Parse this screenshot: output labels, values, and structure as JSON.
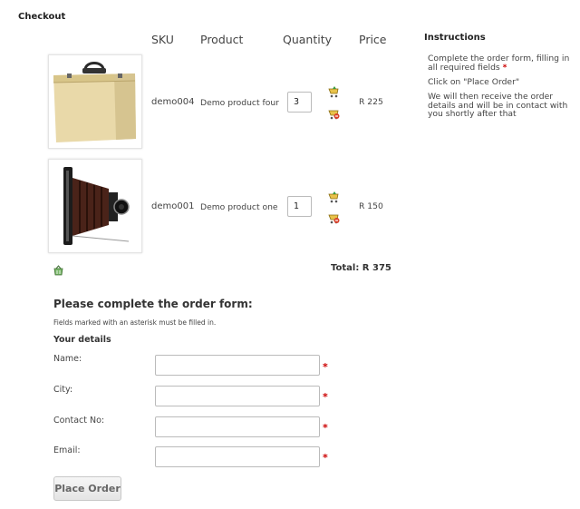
{
  "page": {
    "heading": "Checkout"
  },
  "table": {
    "headers": {
      "sku": "SKU",
      "product": "Product",
      "quantity": "Quantity",
      "price": "Price"
    },
    "rows": [
      {
        "sku": "demo004",
        "product": "Demo product four",
        "quantity": "3",
        "price": "R 225",
        "image": "wooden-case"
      },
      {
        "sku": "demo001",
        "product": "Demo product one",
        "quantity": "1",
        "price": "R 150",
        "image": "vintage-folding-camera"
      }
    ],
    "row_icons": [
      "update-cart-icon",
      "remove-item-icon"
    ],
    "clear_icon": "empty-cart-icon",
    "total": "Total: R 375"
  },
  "instructions": {
    "title": "Instructions",
    "step1": "Complete the order form, filling in all required fields",
    "step1_marker": "*",
    "step2": "Click on \"Place Order\"",
    "step3": "We will then receive the order details and will be in contact with you shortly after that"
  },
  "form": {
    "title": "Please complete the order form:",
    "note": "Fields marked with an asterisk must be filled in.",
    "section": "Your details",
    "required_marker": "*",
    "fields": [
      {
        "label": "Name:",
        "value": ""
      },
      {
        "label": "City:",
        "value": ""
      },
      {
        "label": "Contact No:",
        "value": ""
      },
      {
        "label": "Email:",
        "value": ""
      }
    ],
    "submit": "Place Order"
  },
  "colors": {
    "required": "#cc0000",
    "border": "#bbbbbb"
  }
}
